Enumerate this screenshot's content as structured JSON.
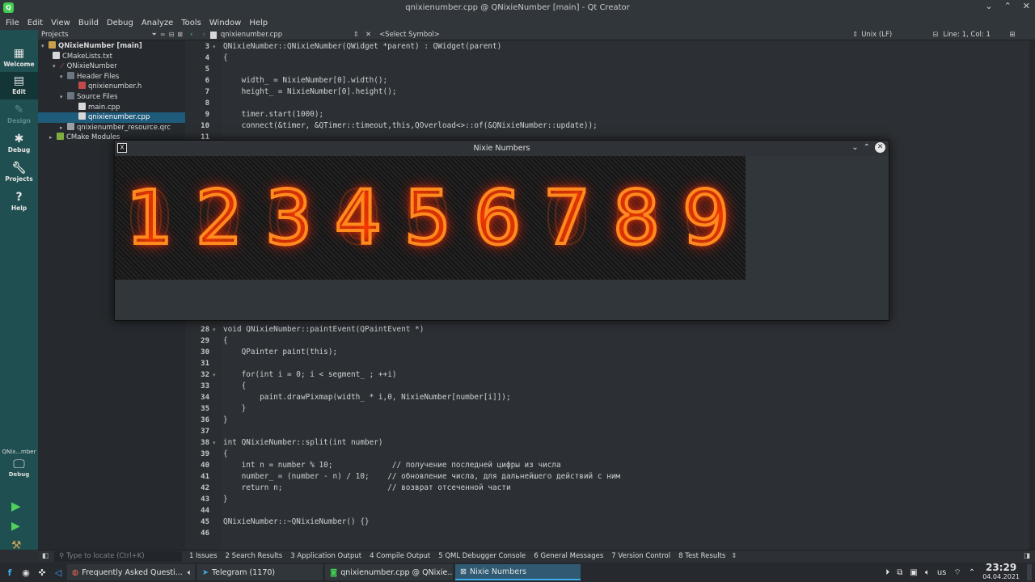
{
  "window": {
    "title": "qnixienumber.cpp @ QNixieNumber [main] - Qt Creator"
  },
  "menu": [
    "File",
    "Edit",
    "View",
    "Build",
    "Debug",
    "Analyze",
    "Tools",
    "Window",
    "Help"
  ],
  "modes": [
    {
      "label": "Welcome",
      "icon": "grid-icon"
    },
    {
      "label": "Edit",
      "icon": "edit-icon"
    },
    {
      "label": "Design",
      "icon": "design-icon"
    },
    {
      "label": "Debug",
      "icon": "bug-icon"
    },
    {
      "label": "Projects",
      "icon": "wrench-icon"
    },
    {
      "label": "Help",
      "icon": "help-icon"
    }
  ],
  "kit": {
    "name": "QNix...mber",
    "mode": "Debug"
  },
  "projects": {
    "header": "Projects",
    "tree": [
      {
        "label": "QNixieNumber [main]",
        "depth": 0,
        "bold": true
      },
      {
        "label": "CMakeLists.txt",
        "depth": 1
      },
      {
        "label": "QNixieNumber",
        "depth": 1
      },
      {
        "label": "Header Files",
        "depth": 2
      },
      {
        "label": "qnixienumber.h",
        "depth": 3
      },
      {
        "label": "Source Files",
        "depth": 2
      },
      {
        "label": "main.cpp",
        "depth": 3
      },
      {
        "label": "qnixienumber.cpp",
        "depth": 3,
        "selected": true
      },
      {
        "label": "qnixienumber_resource.qrc",
        "depth": 2
      },
      {
        "label": "CMake Modules",
        "depth": 1
      }
    ]
  },
  "editor": {
    "file": "qnixienumber.cpp",
    "symbol": "<Select Symbol>",
    "line_ending": "Unix (LF)",
    "position": "Line: 1, Col: 1"
  },
  "code_top": [
    {
      "n": "3",
      "t": "QNixieNumber::QNixieNumber(QWidget *parent) : QWidget(parent)"
    },
    {
      "n": "4",
      "t": "{"
    },
    {
      "n": "5",
      "t": ""
    },
    {
      "n": "6",
      "t": "    width_ = NixieNumber[0].width();"
    },
    {
      "n": "7",
      "t": "    height_ = NixieNumber[0].height();"
    },
    {
      "n": "8",
      "t": ""
    },
    {
      "n": "9",
      "t": "    timer.start(1000);"
    },
    {
      "n": "10",
      "t": "    connect(&timer, &QTimer::timeout,this,QOverload<>::of(&QNixieNumber::update));"
    },
    {
      "n": "11",
      "t": ""
    }
  ],
  "code_bottom": [
    {
      "n": "28",
      "t": "void QNixieNumber::paintEvent(QPaintEvent *)"
    },
    {
      "n": "29",
      "t": "{"
    },
    {
      "n": "30",
      "t": "    QPainter paint(this);"
    },
    {
      "n": "31",
      "t": ""
    },
    {
      "n": "32",
      "t": "    for(int i = 0; i < segment_ ; ++i)"
    },
    {
      "n": "33",
      "t": "    {"
    },
    {
      "n": "34",
      "t": "        paint.drawPixmap(width_ * i,0, NixieNumber[number[i]]);"
    },
    {
      "n": "35",
      "t": "    }"
    },
    {
      "n": "36",
      "t": "}"
    },
    {
      "n": "37",
      "t": ""
    },
    {
      "n": "38",
      "t": "int QNixieNumber::split(int number)"
    },
    {
      "n": "39",
      "t": "{"
    },
    {
      "n": "40",
      "t": "    int n = number % 10;             // получение последней цифры из числа"
    },
    {
      "n": "41",
      "t": "    number_ = (number - n) / 10;    // обновление числа, для дальнейшего действий с ним"
    },
    {
      "n": "42",
      "t": "    return n;                       // возврат отсеченной части"
    },
    {
      "n": "43",
      "t": "}"
    },
    {
      "n": "44",
      "t": ""
    },
    {
      "n": "45",
      "t": "QNixieNumber::~QNixieNumber() {}"
    },
    {
      "n": "46",
      "t": ""
    }
  ],
  "nixie_window": {
    "title": "Nixie Numbers",
    "digits": [
      "1",
      "2",
      "3",
      "4",
      "5",
      "6",
      "7",
      "8",
      "9"
    ]
  },
  "statusbar": {
    "locate_placeholder": "Type to locate (Ctrl+K)",
    "tabs": [
      "1 Issues",
      "2 Search Results",
      "3 Application Output",
      "4 Compile Output",
      "5 QML Debugger Console",
      "6 General Messages",
      "7 Version Control",
      "8 Test Results"
    ]
  },
  "taskbar": {
    "tasks": [
      {
        "label": "Frequently Asked Questi...",
        "active": false
      },
      {
        "label": "Telegram (1170)",
        "active": false
      },
      {
        "label": "qnixienumber.cpp @ QNixie...",
        "active": false
      },
      {
        "label": "Nixie Numbers",
        "active": true
      }
    ],
    "layout": "us",
    "time": "23:29",
    "date": "04.04.2021"
  }
}
